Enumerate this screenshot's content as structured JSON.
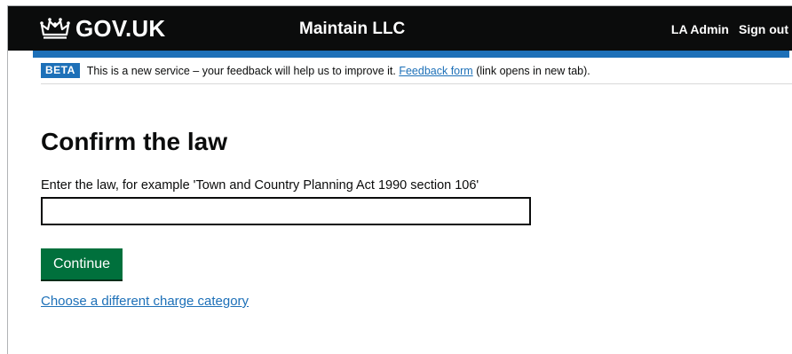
{
  "header": {
    "logo_text": "GOV.UK",
    "logo_icon": "crown-icon",
    "service_name": "Maintain LLC",
    "nav": {
      "user_label": "LA Admin",
      "sign_out_label": "Sign out"
    }
  },
  "phase_banner": {
    "tag": "BETA",
    "text_before": "This is a new service – your feedback will help us to improve it.",
    "feedback_link": "Feedback form",
    "text_after": "(link opens in new tab)."
  },
  "main": {
    "title": "Confirm the law",
    "input_label": "Enter the law, for example 'Town and Country Planning Act 1990 section 106'",
    "input_value": "",
    "continue_button": "Continue",
    "alt_link": "Choose a different charge category"
  },
  "colors": {
    "header_bg": "#0b0c0c",
    "brand_blue": "#1d70b8",
    "button_green": "#00703c",
    "text": "#0b0c0c"
  }
}
